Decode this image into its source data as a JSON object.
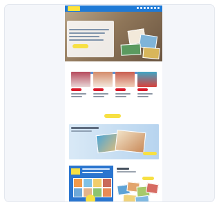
{
  "logo_text": "",
  "nav_count": 7,
  "hero": {
    "title": "",
    "cta": ""
  },
  "subnav": [],
  "products": [
    {
      "image_colors": [
        "#b64a5c",
        "#e8d6d6"
      ]
    },
    {
      "image_colors": [
        "#d48b6a",
        "#f2e7dc"
      ]
    },
    {
      "image_colors": [
        "#c95d4f",
        "#efcfb9"
      ]
    },
    {
      "image_colors": [
        "#3fa6c6",
        "#d8413c"
      ]
    }
  ],
  "colors": {
    "topbar": "#1f7ad6",
    "accent": "#f7e043",
    "badge": "#d91a2b"
  }
}
